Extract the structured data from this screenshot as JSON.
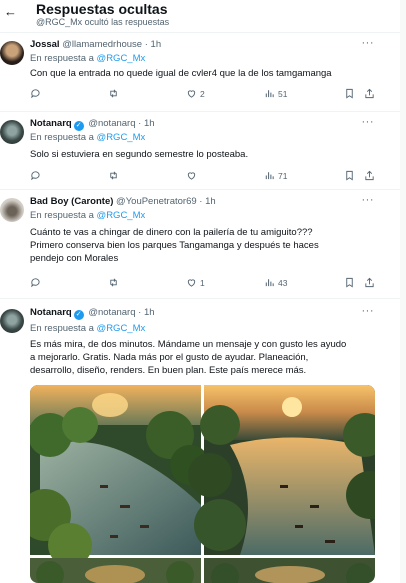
{
  "header": {
    "back_icon": "←",
    "title": "Respuestas ocultas",
    "subtitle": "@RGC_Mx ocultó las respuestas"
  },
  "reply_prefix": "En respuesta a",
  "tweets": [
    {
      "name": "Jossal",
      "handle": "@llamamedrhouse",
      "time": "· 1h",
      "verified": false,
      "reply_to": "@RGC_Mx",
      "text": "Con que la entrada no quede igual de cvler4 que la de los tamgamanga",
      "likes": "2",
      "views": "51"
    },
    {
      "name": "Notanarq",
      "handle": "@notanarq",
      "time": "· 1h",
      "verified": true,
      "reply_to": "@RGC_Mx",
      "text": "Solo si estuviera en segundo semestre lo posteaba.",
      "likes": "",
      "views": "71"
    },
    {
      "name": "Bad Boy (Caronte)",
      "handle": "@YouPenetrator69",
      "time": "· 1h",
      "verified": false,
      "reply_to": "@RGC_Mx",
      "text_lines": [
        "Cuánto te vas a chingar de dinero con la pailería de tu amiguito???",
        "Primero conserva bien los parques Tangamanga y después te haces",
        "pendejo con Morales"
      ],
      "likes": "1",
      "views": "43"
    },
    {
      "name": "Notanarq",
      "handle": "@notanarq",
      "time": "· 1h",
      "verified": true,
      "reply_to": "@RGC_Mx",
      "text_lines": [
        "Es más mira, de dos minutos. Mándame un mensaje y con gusto les ayudo",
        "a mejorarlo. Gratis. Nada más por el gusto de ayudar. Planeación,",
        "desarrollo, diseño, renders. En buen plan. Este país merece más."
      ]
    }
  ],
  "colors": {
    "accent": "#1d9bf0",
    "secondary_text": "#536471",
    "border": "#eff3f4"
  },
  "icons": [
    "back-arrow-icon",
    "reply-icon",
    "retweet-icon",
    "like-icon",
    "views-icon",
    "bookmark-icon",
    "share-icon",
    "more-icon",
    "verified-icon"
  ]
}
